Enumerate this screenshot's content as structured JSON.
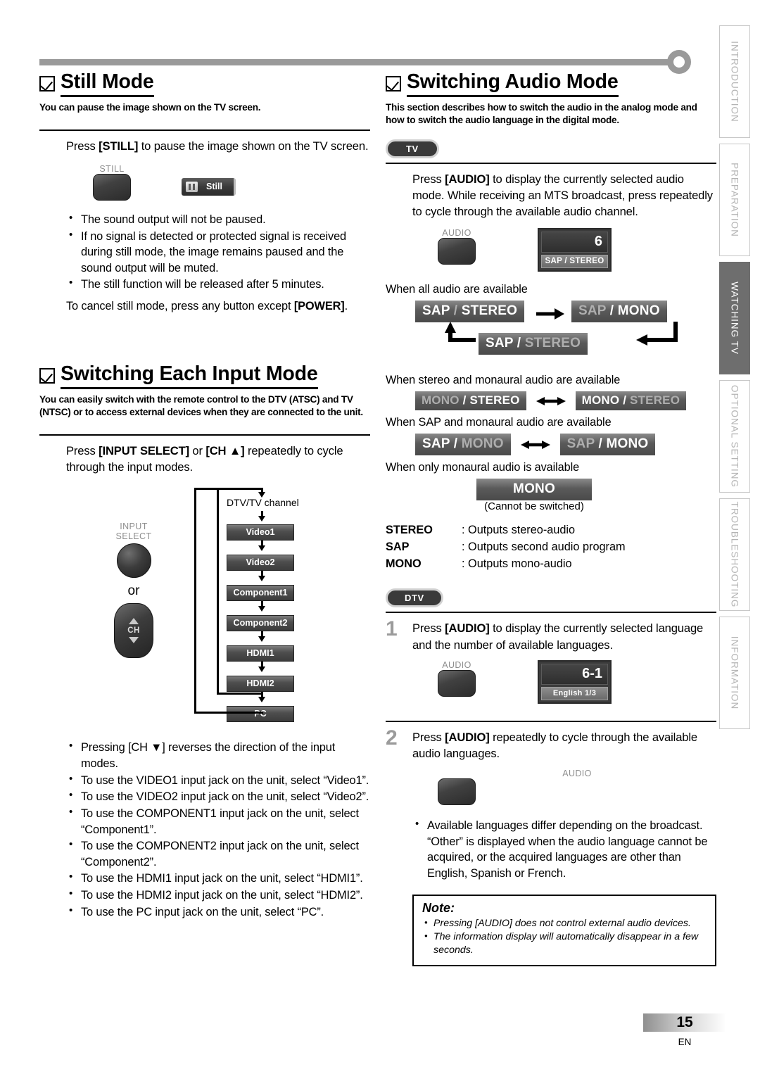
{
  "document": {
    "page_number": "15",
    "language_code": "EN"
  },
  "tabs": [
    {
      "label": "INTRODUCTION",
      "active": false
    },
    {
      "label": "PREPARATION",
      "active": false
    },
    {
      "label": "WATCHING TV",
      "active": true
    },
    {
      "label": "OPTIONAL  SETTING",
      "active": false
    },
    {
      "label": "TROUBLESHOOTING",
      "active": false
    },
    {
      "label": "INFORMATION",
      "active": false
    }
  ],
  "left_column": {
    "still_mode": {
      "heading": "Still Mode",
      "lede": "You can pause the image shown on the TV screen.",
      "step_text_1": "Press ",
      "step_bold_1": "[STILL]",
      "step_text_2": " to pause the image shown on the TV screen.",
      "button_caption": "STILL",
      "osd_label": "Still",
      "bullets": [
        "The sound output will not be paused.",
        "If no signal is detected or protected signal is received during still mode, the image remains paused and the sound output will be muted.",
        "The still function will be released after 5 minutes."
      ],
      "cancel_text_1": "To cancel still mode, press any button except ",
      "cancel_bold": "[POWER]",
      "cancel_text_2": "."
    },
    "input_mode": {
      "heading": "Switching Each Input Mode",
      "lede": "You can easily switch with the remote control to the DTV (ATSC) and TV (NTSC) or to access external devices when they are connected to the unit.",
      "step_text_1": "Press ",
      "step_bold_1": "[INPUT SELECT]",
      "step_text_2": " or ",
      "step_bold_2": "[CH ▲]",
      "step_text_3": " repeatedly to cycle through the input modes.",
      "input_select_caption_line1": "INPUT",
      "input_select_caption_line2": "SELECT",
      "or_label": "or",
      "ch_label": "CH",
      "flow_caption": "DTV/TV channel",
      "flow_items": [
        "Video1",
        "Video2",
        "Component1",
        "Component2",
        "HDMI1",
        "HDMI2",
        "PC"
      ],
      "bullets": [
        "Pressing [CH ▼] reverses the direction of the input modes.",
        "To use the VIDEO1 input jack on the unit, select “Video1”.",
        "To use the VIDEO2 input jack on the unit, select “Video2”.",
        "To use the COMPONENT1 input jack on the unit, select “Component1”.",
        "To use the COMPONENT2 input jack on the unit, select “Component2”.",
        "To use the HDMI1 input jack on the unit, select “HDMI1”.",
        "To use the HDMI2 input jack on the unit, select “HDMI2”.",
        "To use the PC input jack on the unit, select “PC”."
      ]
    }
  },
  "right_column": {
    "audio_mode": {
      "heading": "Switching Audio Mode",
      "lede": "This section describes how to switch the audio in the analog mode and how to switch the audio language in the digital mode.",
      "tv_badge": "TV",
      "tv_step_text_1": "Press ",
      "tv_step_bold": "[AUDIO]",
      "tv_step_text_2": " to display the currently selected audio mode. While receiving an MTS broadcast, press repeatedly to cycle through the available audio channel.",
      "audio_button_caption": "AUDIO",
      "osd_channel": "6",
      "osd_mode": "SAP / STEREO",
      "cond_all": "When all audio are available",
      "cycle_all": [
        {
          "left": "SAP",
          "right": "STEREO",
          "highlight": "right"
        },
        {
          "left": "SAP",
          "right": "MONO",
          "highlight": "right"
        },
        {
          "left": "SAP",
          "right": "STEREO",
          "highlight": "left"
        }
      ],
      "cond_stereo_mono": "When stereo and monaural audio are available",
      "cycle_stereo_mono": [
        {
          "left": "MONO",
          "right": "STEREO",
          "highlight": "right"
        },
        {
          "left": "MONO",
          "right": "STEREO",
          "highlight": "left"
        }
      ],
      "cond_sap_mono": "When SAP and monaural audio are available",
      "cycle_sap_mono": [
        {
          "left": "SAP",
          "right": "MONO",
          "highlight": "left"
        },
        {
          "left": "SAP",
          "right": "MONO",
          "highlight": "right"
        }
      ],
      "cond_mono_only": "When only monaural audio is available",
      "mono_badge": "MONO",
      "mono_note": "(Cannot be switched)",
      "definitions": [
        {
          "term": "STEREO",
          "desc": ": Outputs stereo-audio"
        },
        {
          "term": "SAP",
          "desc": ": Outputs second audio program"
        },
        {
          "term": "MONO",
          "desc": ": Outputs mono-audio"
        }
      ],
      "dtv_badge": "DTV",
      "dtv_step1_num": "1",
      "dtv_step1_text_1": "Press ",
      "dtv_step1_bold": "[AUDIO]",
      "dtv_step1_text_2": " to display the currently selected language and the number of available languages.",
      "dtv_osd_channel": "6-1",
      "dtv_osd_lang": "English 1/3",
      "dtv_step2_num": "2",
      "dtv_step2_text_1": "Press ",
      "dtv_step2_bold": "[AUDIO]",
      "dtv_step2_text_2": " repeatedly to cycle through the available audio languages.",
      "bullets": [
        "Available languages differ depending on the broadcast. “Other” is displayed when the audio language cannot be acquired, or the acquired languages are other than English, Spanish or French."
      ],
      "note_title": "Note:",
      "note_items": [
        "Pressing [AUDIO] does not control external audio devices.",
        "The information display will automatically disappear in a few seconds."
      ]
    }
  }
}
